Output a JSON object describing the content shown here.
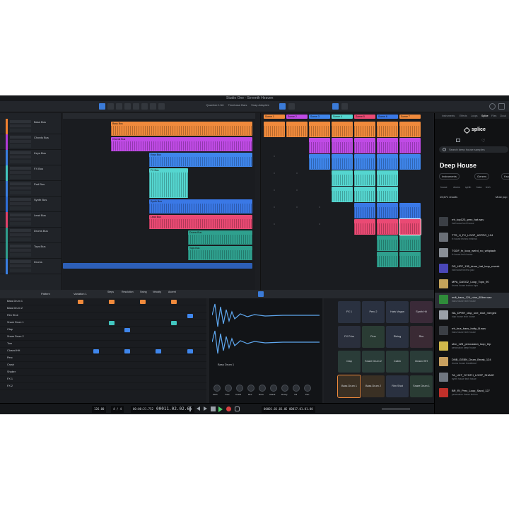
{
  "window": {
    "title": "Studio One - Seventh Heaven"
  },
  "toolbar": {
    "labels": [
      "Quantize 1/16",
      "Timebase Bars",
      "Snap Adaptive"
    ]
  },
  "tracks": [
    {
      "name": "Bass Bus",
      "color": "#f08030"
    },
    {
      "name": "Chords Bus",
      "color": "#b03ad8"
    },
    {
      "name": "Keys Bus",
      "color": "#3a7ee0"
    },
    {
      "name": "FX Bus",
      "color": "#42c6c0"
    },
    {
      "name": "Pad Bus",
      "color": "#3a7ee0"
    },
    {
      "name": "Synth Bus",
      "color": "#2f6ed8"
    },
    {
      "name": "Lead Bus",
      "color": "#e0406a"
    },
    {
      "name": "Drums Bus",
      "color": "#2f9d8c"
    },
    {
      "name": "Tops Bus",
      "color": "#2f9d8c"
    },
    {
      "name": "Drums",
      "color": "#3a7ee0"
    }
  ],
  "arrangement_clips": [
    {
      "label": "Bass Bus",
      "color": "#f08a3c"
    },
    {
      "label": "Chords Bus",
      "color": "#c04be6"
    },
    {
      "label": "Keys Bus",
      "color": "#3f86ec"
    },
    {
      "label": "FX Bus",
      "color": "#55d6d0"
    },
    {
      "label": "Synth Bus",
      "color": "#3a78e6"
    },
    {
      "label": "Lead Bus",
      "color": "#ea4a74"
    },
    {
      "label": "Drums Bus",
      "color": "#2fa08e"
    },
    {
      "label": "Tops Bus",
      "color": "#2fa08e"
    }
  ],
  "scenes": [
    "Scene 1",
    "Scene 2",
    "Scene 3",
    "Scene 4",
    "Scene 5",
    "Scene 6",
    "Scene 7"
  ],
  "splice": {
    "tabs": [
      "Instruments",
      "Effects",
      "Loops",
      "Splice",
      "Files",
      "Cloud",
      "Sh"
    ],
    "logo": "splice",
    "search_placeholder": "Search deep house samples",
    "title": "Deep House",
    "filters": [
      "Instruments",
      "Genres",
      "Key"
    ],
    "tags": [
      "house",
      "drums",
      "synth",
      "bass",
      "tech"
    ],
    "count": "15,671 results",
    "sort": "Most pop",
    "results": [
      {
        "file": "rrh_top123_perc_hat.wav",
        "tags": "hat  house  tech house",
        "color": "#3b3f45"
      },
      {
        "file": "TTS_H_FX_LOOP_ASTRO_124",
        "tags": "fx  house  techno  minimal",
        "color": "#6a6f77"
      },
      {
        "file": "TGDF_fx_loop_weird_no_whiplash",
        "tags": "fx  house  tech house",
        "color": "#8a8f97"
      },
      {
        "file": "DS_HPP_135_drum_hat_loop_reverb",
        "tags": "hat  house  techno  jazz",
        "color": "#4a47b8"
      },
      {
        "file": "MPA_DASG2_Loop_Tops_90",
        "tags": "drums  house  techno  tops",
        "color": "#c4a35a"
      },
      {
        "file": "mdt_bass_124_nine_85bm.wav",
        "tags": "bass  house  tech house",
        "color": "#2f8c3a"
      },
      {
        "file": "NA_DPRH_clap_one_shot_merged",
        "tags": "clap  house  tech house",
        "color": "#9aa0a8"
      },
      {
        "file": "rrh_bus_bass_hotty_B.wav",
        "tags": "bass  house  tech house",
        "color": "#3b3f45"
      },
      {
        "file": "sfvn_125_percussion_loop_trip",
        "tags": "percussion  deep house",
        "color": "#d0b84a"
      },
      {
        "file": "DNB_GEBN_Drum_Break_124",
        "tags": "drums  house  breakbeat",
        "color": "#c8a060"
      },
      {
        "file": "TA_UKT_SYNTH_LOOP_SHAKE",
        "tags": "synth  house  tech house",
        "color": "#707680"
      },
      {
        "file": "BR_RI_Perc_Loop_Sand_127",
        "tags": "percussion  house  techno",
        "color": "#c0302a"
      }
    ]
  },
  "editor": {
    "toolbar_labels": [
      "Pattern",
      "Variation 1",
      "Steps",
      "Resolution",
      "Swing",
      "Velocity",
      "Accent"
    ],
    "pads_rows": [
      "Bass Drum 1",
      "Bass Drum 2",
      "Rim Shot",
      "Snare Drum 1",
      "Clap",
      "Snare Drum 2",
      "Tom",
      "Closed HH",
      "Perc",
      "Crash",
      "Shaker",
      "FX 1",
      "FX 2"
    ],
    "sampler_title": "Bass Drum 1",
    "sampler_knobs": [
      "Pitch",
      "Tune",
      "Cutoff",
      "Res",
      "Drive",
      "Attack",
      "Decay",
      "Vol",
      "Pan"
    ],
    "pads": [
      [
        "FX 1",
        "Perc 2",
        "Hats Vegan",
        "Synth Hit"
      ],
      [
        "FX Prim",
        "Perc",
        "Rising",
        "Rim"
      ],
      [
        "Clap",
        "Snare Drum 2",
        "Cabin",
        "Closed HH"
      ],
      [
        "Bass Drum 1",
        "Bass Drum 2",
        "Rim Shot",
        "Snare Drum 1"
      ]
    ]
  },
  "transport": {
    "tempo": "126.00",
    "signature": "4 / 4",
    "position": "00011.02.02.65",
    "time": "00:00:21.752",
    "loop_start": "00001.01.01.00",
    "loop_end": "00017.01.01.00"
  }
}
